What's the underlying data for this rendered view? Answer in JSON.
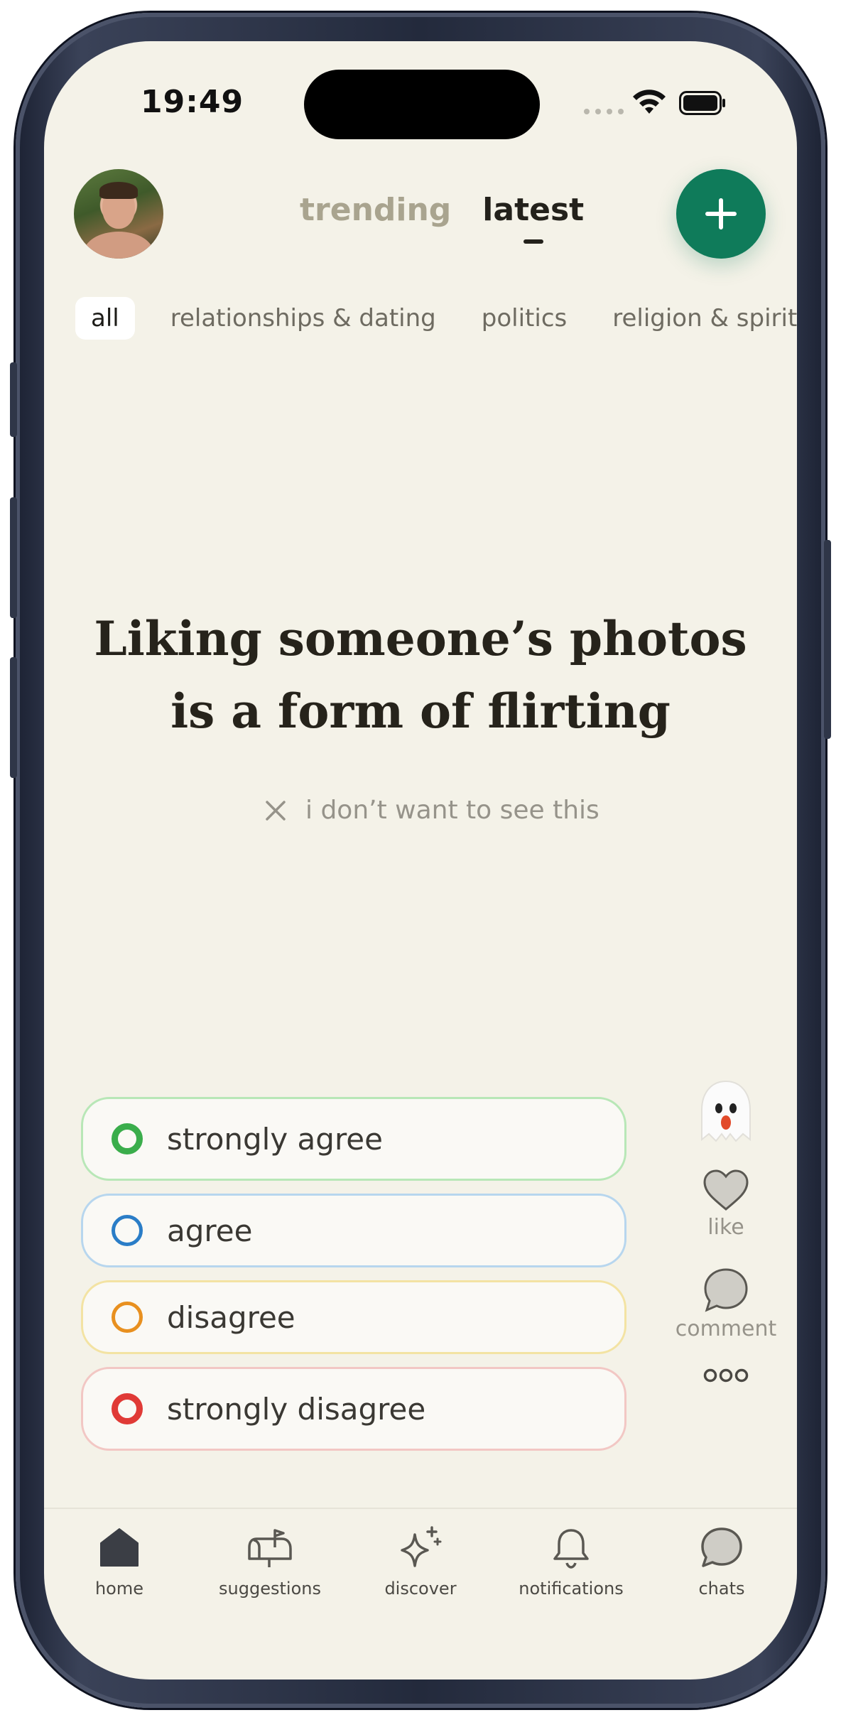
{
  "status_bar": {
    "time": "19:49"
  },
  "header": {
    "tabs": [
      {
        "label": "trending",
        "active": false
      },
      {
        "label": "latest",
        "active": true
      }
    ],
    "new_post_icon": "plus-icon"
  },
  "categories": [
    {
      "label": "all",
      "active": true
    },
    {
      "label": "relationships & dating",
      "active": false
    },
    {
      "label": "politics",
      "active": false
    },
    {
      "label": "religion & spirituali",
      "active": false
    }
  ],
  "question": {
    "text": "Liking someone’s photos is a form of flirting",
    "hide_label": "i don’t want to see this"
  },
  "options": [
    {
      "label": "strongly agree",
      "color": "#3aad4b"
    },
    {
      "label": "agree",
      "color": "#2a7dc7"
    },
    {
      "label": "disagree",
      "color": "#e8901f"
    },
    {
      "label": "strongly disagree",
      "color": "#e03a36"
    }
  ],
  "actions": {
    "ghost_emoji": "👻",
    "like_label": "like",
    "comment_label": "comment"
  },
  "bottom_nav": [
    {
      "label": "home",
      "icon": "home-icon",
      "active": true
    },
    {
      "label": "suggestions",
      "icon": "mailbox-icon",
      "active": false
    },
    {
      "label": "discover",
      "icon": "sparkle-icon",
      "active": false
    },
    {
      "label": "notifications",
      "icon": "bell-icon",
      "active": false
    },
    {
      "label": "chats",
      "icon": "chat-bubble-icon",
      "active": false
    }
  ],
  "colors": {
    "background": "#f4f2e8",
    "accent": "#0f7b5a"
  }
}
